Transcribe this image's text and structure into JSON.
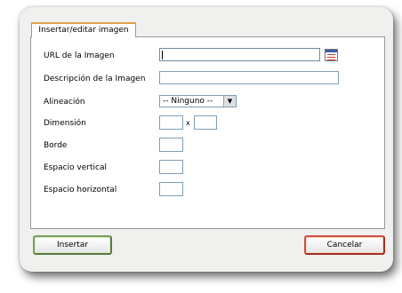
{
  "dialog": {
    "tab_label": "Insertar/editar imagen",
    "fields": {
      "url_label": "URL de la Imagen",
      "url_value": "",
      "description_label": "Descripción de la Imagen",
      "description_value": "",
      "alignment_label": "Alineación",
      "alignment_value": "-- Ninguno --",
      "dimension_label": "Dimensión",
      "width_value": "",
      "dimension_separator": "x",
      "height_value": "",
      "border_label": "Borde",
      "border_value": "",
      "vspace_label": "Espacio vertical",
      "vspace_value": "",
      "hspace_label": "Espacio horizontal",
      "hspace_value": ""
    },
    "buttons": {
      "insert_label": "Insertar",
      "cancel_label": "Cancelar"
    },
    "icons": {
      "browse": "image-browse-icon",
      "dropdown": "chevron-down-icon"
    },
    "colors": {
      "tab_accent": "#e0a24a",
      "insert_border": "#7ba05b",
      "cancel_border": "#d05040"
    }
  }
}
